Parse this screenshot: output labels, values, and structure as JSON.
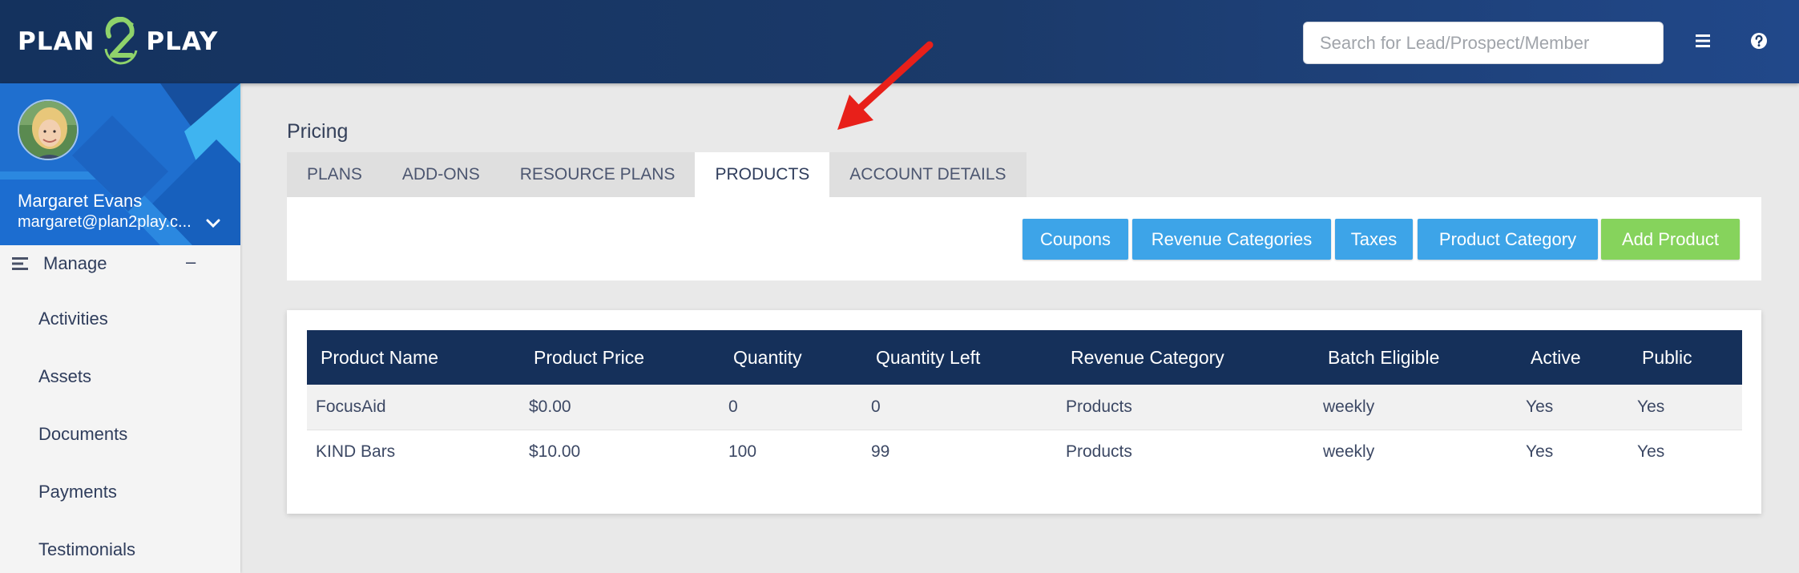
{
  "brand": {
    "left": "PLAN",
    "right": "PLAY",
    "digit": "2"
  },
  "search": {
    "placeholder": "Search for Lead/Prospect/Member"
  },
  "user": {
    "name": "Margaret Evans",
    "email": "margaret@plan2play.c..."
  },
  "sidebar": {
    "manage_label": "Manage",
    "collapse_symbol": "–",
    "items": [
      {
        "label": "Activities"
      },
      {
        "label": "Assets"
      },
      {
        "label": "Documents"
      },
      {
        "label": "Payments"
      },
      {
        "label": "Testimonials"
      }
    ]
  },
  "page": {
    "title": "Pricing"
  },
  "tabs": [
    {
      "label": "PLANS",
      "active": false
    },
    {
      "label": "ADD-ONS",
      "active": false
    },
    {
      "label": "RESOURCE PLANS",
      "active": false
    },
    {
      "label": "PRODUCTS",
      "active": true
    },
    {
      "label": "ACCOUNT DETAILS",
      "active": false
    }
  ],
  "toolbar": {
    "coupons": "Coupons",
    "revenue_categories": "Revenue Categories",
    "taxes": "Taxes",
    "product_category": "Product Category",
    "add_product": "Add Product"
  },
  "table": {
    "headers": [
      "Product Name",
      "Product Price",
      "Quantity",
      "Quantity Left",
      "Revenue Category",
      "Batch Eligible",
      "Active",
      "Public"
    ],
    "rows": [
      [
        "FocusAid",
        "$0.00",
        "0",
        "0",
        "Products",
        "weekly",
        "Yes",
        "Yes"
      ],
      [
        "KIND Bars",
        "$10.00",
        "100",
        "99",
        "Products",
        "weekly",
        "Yes",
        "Yes"
      ]
    ]
  },
  "colors": {
    "header_navy": "#15305a",
    "button_blue": "#3da4e8",
    "button_green": "#86d35c",
    "logo_green": "#8fd36b",
    "annotation_red": "#e8201a"
  },
  "icons": {
    "menu": "hamburger-icon",
    "help": "question-circle-icon",
    "expand": "chevron-down-icon",
    "manage": "list-icon",
    "annotation": "red-arrow-icon"
  }
}
